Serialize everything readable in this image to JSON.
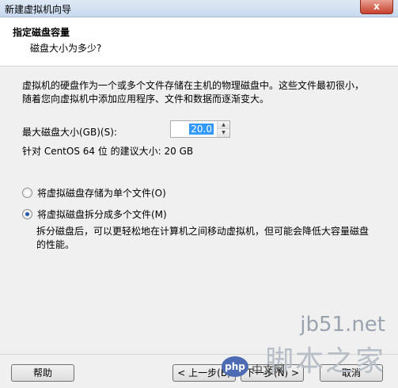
{
  "window": {
    "title": "新建虚拟机向导",
    "close_label": "x"
  },
  "header": {
    "title": "指定磁盘容量",
    "subtitle": "磁盘大小为多少?"
  },
  "description": "虚拟机的硬盘作为一个或多个文件存储在主机的物理磁盘中。这些文件最初很小，随着您向虚拟机中添加应用程序、文件和数据而逐渐变大。",
  "disk_size": {
    "label": "最大磁盘大小(GB)(S):",
    "value": "20.0",
    "recommended": "针对 CentOS 64 位 的建议大小: 20 GB"
  },
  "storage_options": [
    {
      "label": "将虚拟磁盘存储为单个文件(O)",
      "selected": false
    },
    {
      "label": "将虚拟磁盘拆分成多个文件(M)",
      "selected": true
    }
  ],
  "split_note": "拆分磁盘后，可以更轻松地在计算机之间移动虚拟机，但可能会降低大容量磁盘的性能。",
  "footer": {
    "help": "帮助",
    "back": "< 上一步(B)",
    "next": "下一步(N) >",
    "cancel": "取消"
  },
  "watermark": {
    "site": "jb51.net",
    "main": "脚本之家",
    "badge": "php",
    "badge_text": "中文网"
  }
}
